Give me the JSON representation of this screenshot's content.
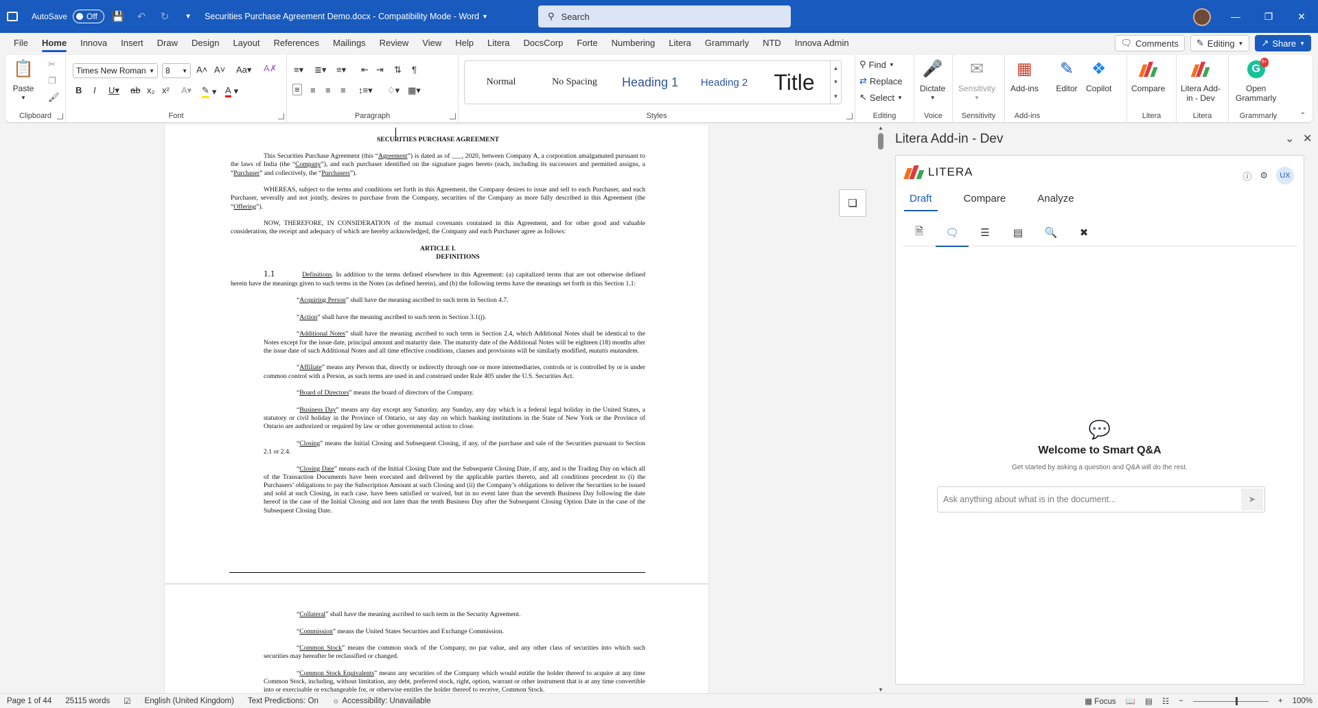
{
  "titlebar": {
    "autosave_label": "AutoSave",
    "autosave_state": "Off",
    "doc_title": "Securities Purchase Agreement Demo.docx  -  Compatibility Mode  -  Word",
    "search_placeholder": "Search"
  },
  "menu": {
    "tabs": [
      "File",
      "Home",
      "Innova",
      "Insert",
      "Draw",
      "Design",
      "Layout",
      "References",
      "Mailings",
      "Review",
      "View",
      "Help",
      "Litera",
      "DocsCorp",
      "Forte",
      "Numbering",
      "Litera",
      "Grammarly",
      "NTD",
      "Innova Admin"
    ],
    "comments": "Comments",
    "editing": "Editing",
    "share": "Share"
  },
  "ribbon": {
    "clipboard": {
      "paste": "Paste",
      "label": "Clipboard"
    },
    "font": {
      "family": "Times New Roman",
      "size": "8",
      "label": "Font"
    },
    "paragraph": {
      "label": "Paragraph"
    },
    "styles": {
      "items": [
        "Normal",
        "No Spacing",
        "Heading 1",
        "Heading 2",
        "Title"
      ],
      "label": "Styles"
    },
    "editing": {
      "find": "Find",
      "replace": "Replace",
      "select": "Select",
      "label": "Editing"
    },
    "voice": {
      "dictate": "Dictate",
      "label": "Voice"
    },
    "sensitivity": {
      "btn": "Sensitivity",
      "label": "Sensitivity"
    },
    "addins": {
      "btn": "Add-ins",
      "label": "Add-ins"
    },
    "editor": "Editor",
    "copilot": "Copilot",
    "litera1": {
      "btn": "Compare",
      "label": "Litera"
    },
    "litera2": {
      "btn1": "Litera Add-",
      "btn2": "in - Dev",
      "label": "Litera"
    },
    "grammarly": {
      "btn1": "Open",
      "btn2": "Grammarly",
      "label": "Grammarly",
      "badge": "5+"
    }
  },
  "document": {
    "title": "SECURITIES PURCHASE AGREEMENT",
    "article": "ARTICLE I.",
    "definitions": "DEFINITIONS",
    "section_num": "1.1"
  },
  "pane": {
    "title": "Litera Add-in - Dev",
    "brand": "LITERA",
    "user": "UX",
    "tabs": [
      "Draft",
      "Compare",
      "Analyze"
    ],
    "welcome_title": "Welcome to Smart Q&A",
    "welcome_sub": "Get started by asking a question and Q&A will do the rest.",
    "ask_placeholder": "Ask anything about what is in the document..."
  },
  "status": {
    "page": "Page 1 of 44",
    "words": "25115 words",
    "lang": "English (United Kingdom)",
    "predictions": "Text Predictions: On",
    "accessibility": "Accessibility: Unavailable",
    "focus": "Focus",
    "zoom": "100%"
  },
  "colors": {
    "brand": "#185abd",
    "litera_orange": "#f36f21",
    "litera_red": "#e03a3e",
    "litera_green": "#3aa655"
  }
}
